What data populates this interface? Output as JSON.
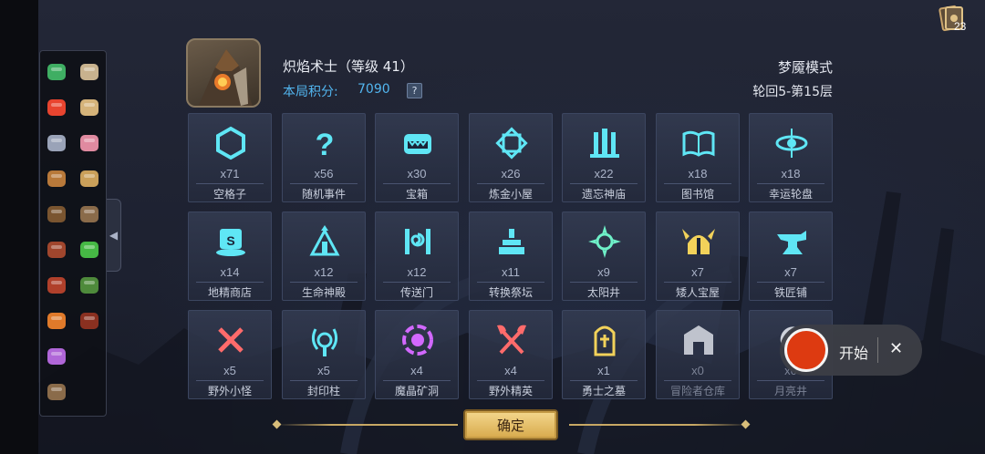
{
  "header": {
    "character_title": "炽焰术士（等级 41）",
    "score_label": "本局积分:",
    "score_value": "7090",
    "help_label": "?",
    "mode": "梦魇模式",
    "cycle": "轮回5-第15层"
  },
  "deck": {
    "count": "23",
    "icon": "card-deck-icon"
  },
  "collapse_arrow": "◀",
  "tiles": [
    {
      "count": "x71",
      "name": "空格子",
      "icon": "hexagon-icon",
      "color": "#5fe6f5"
    },
    {
      "count": "x56",
      "name": "随机事件",
      "icon": "question-icon",
      "color": "#5fe6f5"
    },
    {
      "count": "x30",
      "name": "宝箱",
      "icon": "treasure-chest-icon",
      "color": "#5fe6f5"
    },
    {
      "count": "x26",
      "name": "炼金小屋",
      "icon": "alchemy-icon",
      "color": "#5fe6f5"
    },
    {
      "count": "x22",
      "name": "遗忘神庙",
      "icon": "temple-icon",
      "color": "#5fe6f5"
    },
    {
      "count": "x18",
      "name": "图书馆",
      "icon": "book-icon",
      "color": "#5fe6f5"
    },
    {
      "count": "x18",
      "name": "幸运轮盘",
      "icon": "wheel-icon",
      "color": "#5fe6f5"
    },
    {
      "count": "x14",
      "name": "地精商店",
      "icon": "shop-icon",
      "color": "#5fe6f5"
    },
    {
      "count": "x12",
      "name": "生命神殿",
      "icon": "life-shrine-icon",
      "color": "#5fe6f5"
    },
    {
      "count": "x12",
      "name": "传送门",
      "icon": "portal-icon",
      "color": "#5fe6f5"
    },
    {
      "count": "x11",
      "name": "转换祭坛",
      "icon": "altar-icon",
      "color": "#5fe6f5"
    },
    {
      "count": "x9",
      "name": "太阳井",
      "icon": "sun-icon",
      "color": "#6ff0c8"
    },
    {
      "count": "x7",
      "name": "矮人宝屋",
      "icon": "dwarf-helmet-icon",
      "color": "#f2d25a"
    },
    {
      "count": "x7",
      "name": "铁匠铺",
      "icon": "anvil-icon",
      "color": "#5fe6f5"
    },
    {
      "count": "x5",
      "name": "野外小怪",
      "icon": "crossed-swords-icon",
      "color": "#ff6b6b"
    },
    {
      "count": "x5",
      "name": "封印柱",
      "icon": "seal-pillar-icon",
      "color": "#5fe6f5"
    },
    {
      "count": "x4",
      "name": "魔晶矿洞",
      "icon": "crystal-mine-icon",
      "color": "#d268ff"
    },
    {
      "count": "x4",
      "name": "野外精英",
      "icon": "crossed-axes-icon",
      "color": "#ff6b6b"
    },
    {
      "count": "x1",
      "name": "勇士之墓",
      "icon": "tomb-icon",
      "color": "#f2d25a"
    },
    {
      "count": "x0",
      "name": "冒险者仓库",
      "icon": "warehouse-icon",
      "color": "#cfd3dc"
    },
    {
      "count": "x0",
      "name": "月亮井",
      "icon": "moon-icon",
      "color": "#cfd3dc"
    }
  ],
  "footer": {
    "confirm_label": "确定"
  },
  "recorder": {
    "start_label": "开始",
    "close_label": "✕"
  }
}
